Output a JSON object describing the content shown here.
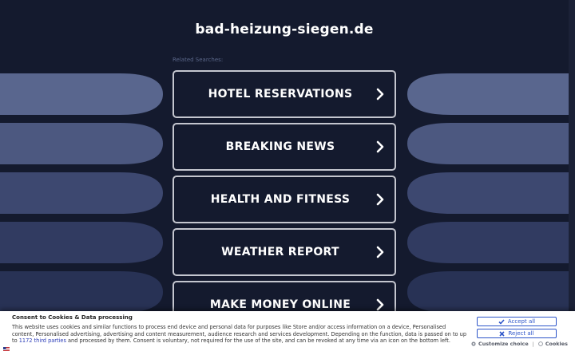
{
  "page": {
    "site_title": "bad-heizung-siegen.de",
    "related_label": "Related Searches:"
  },
  "links": [
    {
      "label": "HOTEL RESERVATIONS"
    },
    {
      "label": "BREAKING NEWS"
    },
    {
      "label": "HEALTH AND FITNESS"
    },
    {
      "label": "WEATHER REPORT"
    },
    {
      "label": "MAKE MONEY ONLINE"
    }
  ],
  "consent": {
    "title": "Consent to Cookies & Data processing",
    "text_1": "This website uses cookies and similar functions to process end device and personal data for purposes like Store and/or access information on a device, Personalised content, Personalised advertising, advertising and content measurement, audience research and services development. Depending on the function, data is passed on to up to ",
    "third_parties_link": "1172 third parties",
    "text_2": " and processed by them. Consent is voluntary, not required for the use of the site, and can be revoked at any time via an icon on the bottom left.",
    "accept_label": "Accept all",
    "reject_label": "Reject all",
    "customize_label": "Customize choice",
    "separator": "|",
    "cookies_label": "Cookies"
  },
  "colors": {
    "background": "#141a2e",
    "button_border": "#c4c6cf",
    "accent_blue": "#2d55c9"
  }
}
